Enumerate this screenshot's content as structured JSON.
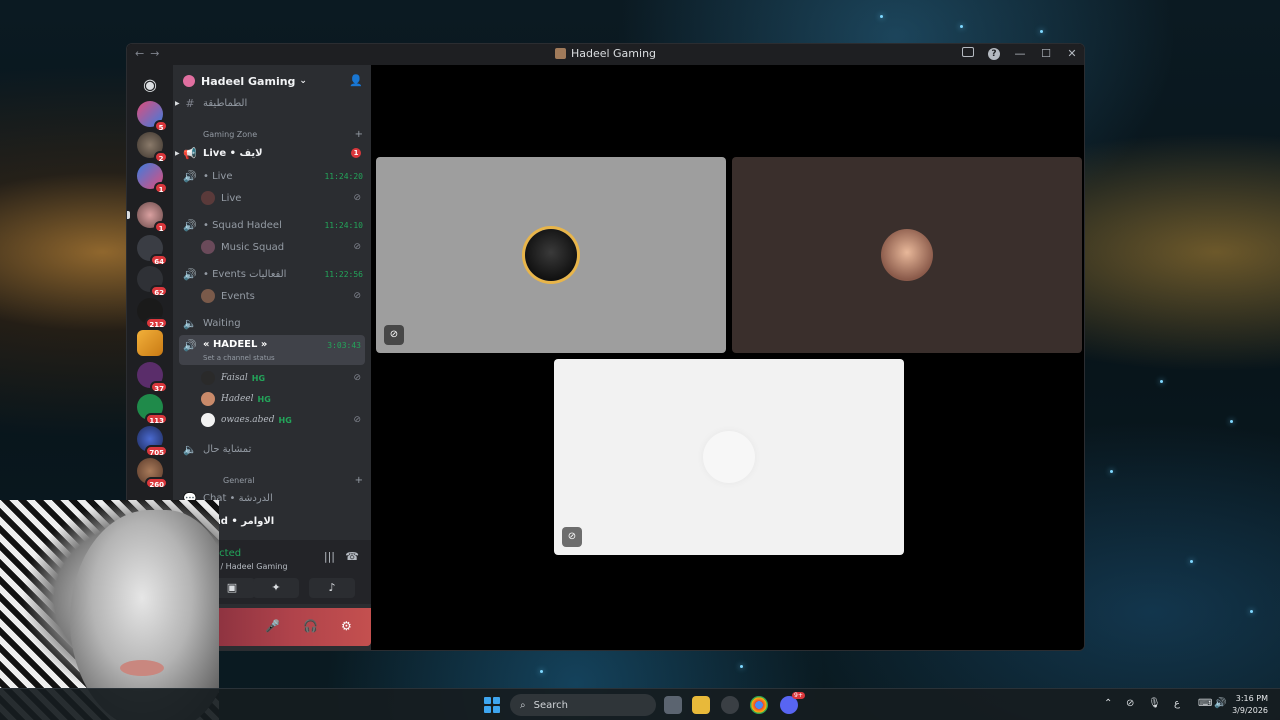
{
  "window": {
    "title": "Hadeel Gaming"
  },
  "sidebar": {
    "server_name": "Hadeel Gaming",
    "top_channel": "الطماطيقة",
    "category_gaming": "Gaming Zone",
    "category_general": "General",
    "channels": [
      {
        "label": "Live • لايف",
        "mention": "1"
      },
      {
        "label": "• Live",
        "time": "11:24:20"
      },
      {
        "label": "Live"
      },
      {
        "label": "• Squad Hadeel",
        "time": "11:24:10"
      },
      {
        "label": "Music Squad"
      },
      {
        "label": "• Events الفعاليات",
        "time": "11:22:56"
      },
      {
        "label": "Events"
      },
      {
        "label": "Waiting"
      }
    ],
    "active_channel": {
      "label": "« HADEEL »",
      "time": "3:03:43",
      "status": "Set a channel status"
    },
    "members": [
      {
        "name": "Faisal",
        "tag": "HG"
      },
      {
        "name": "Hadeel",
        "tag": "HG"
      },
      {
        "name": "owaes.abed",
        "tag": "HG"
      }
    ],
    "other_voice": "تمشاية حال",
    "text_channels": [
      {
        "label": "Chat • الدردشة"
      },
      {
        "label": "Cmd • الاوامر"
      }
    ]
  },
  "server_badges": [
    "5",
    "2",
    "1",
    "1",
    "64",
    "62",
    "212",
    "",
    "37",
    "113",
    "705",
    "260"
  ],
  "voice_panel": {
    "status": "ected",
    "channel": "» / Hadeel Gaming"
  },
  "taskbar": {
    "search_placeholder": "Search",
    "time": "3:16 PM",
    "date": "3/9/2026",
    "lang": "ع",
    "discord_badge": "9+"
  }
}
